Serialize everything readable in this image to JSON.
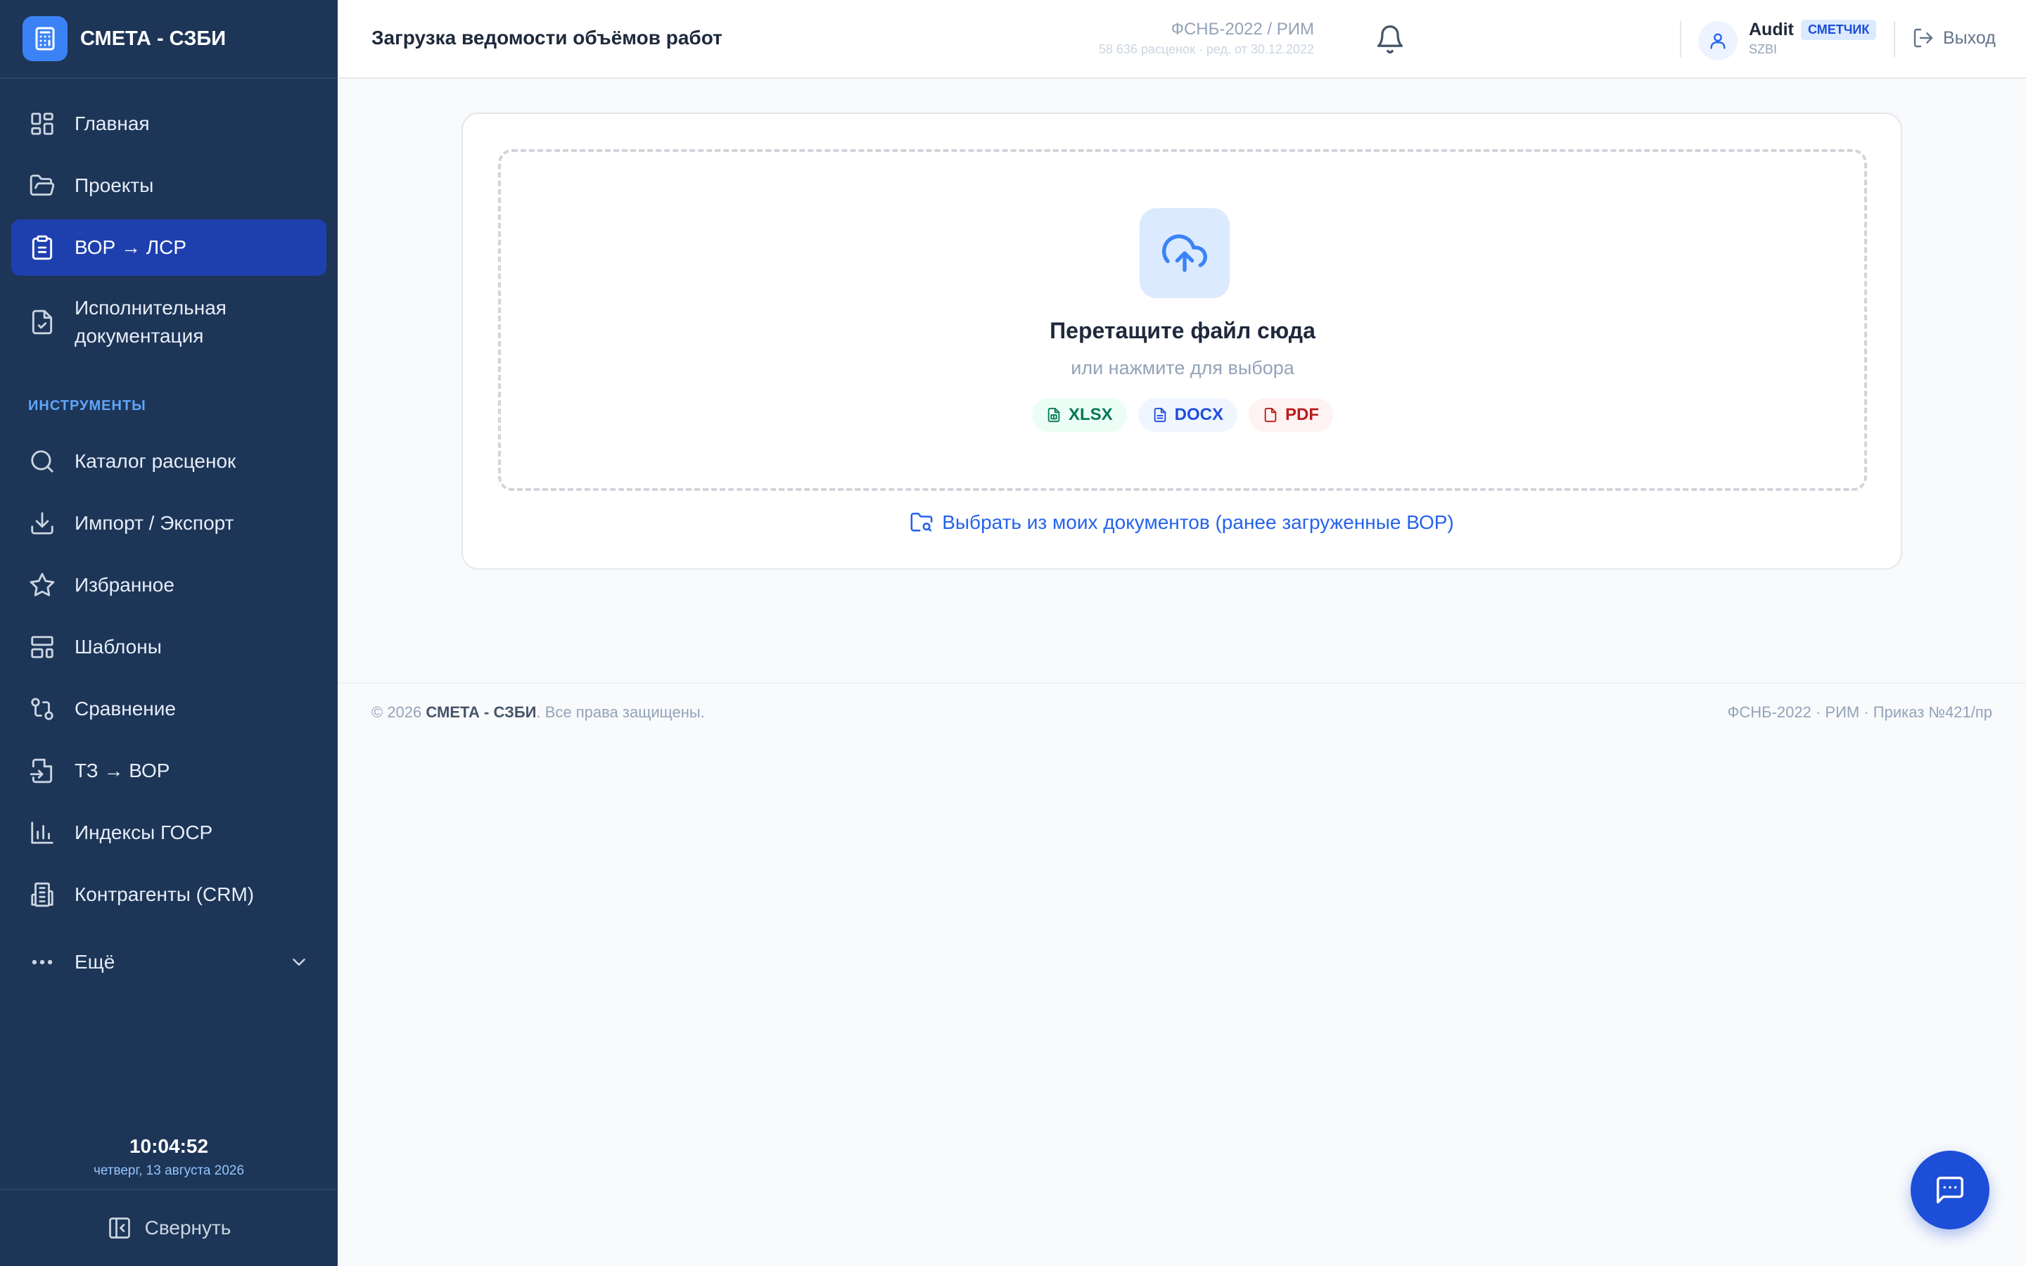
{
  "app": {
    "name": "СМЕТА - СЗБИ"
  },
  "sidebar": {
    "items": [
      {
        "label": "Главная",
        "icon": "dashboard-icon",
        "active": false
      },
      {
        "label": "Проекты",
        "icon": "folder-open-icon",
        "active": false
      },
      {
        "label": "ВОР → ЛСР",
        "icon": "clipboard-icon",
        "active": true
      },
      {
        "label": "Исполнительная документация",
        "icon": "file-check-icon",
        "active": false
      }
    ],
    "tools_section_label": "ИНСТРУМЕНТЫ",
    "tools": [
      {
        "label": "Каталог расценок",
        "icon": "search-icon"
      },
      {
        "label": "Импорт / Экспорт",
        "icon": "download-icon"
      },
      {
        "label": "Избранное",
        "icon": "star-icon"
      },
      {
        "label": "Шаблоны",
        "icon": "layout-template-icon"
      },
      {
        "label": "Сравнение",
        "icon": "git-compare-icon"
      },
      {
        "label": "ТЗ → ВОР",
        "icon": "file-import-icon"
      },
      {
        "label": "Индексы ГОСР",
        "icon": "bar-chart-icon"
      },
      {
        "label": "Контрагенты (CRM)",
        "icon": "building-icon"
      }
    ],
    "more_label": "Ещё",
    "clock_time": "10:04:52",
    "clock_date": "четверг, 13 августа 2026",
    "collapse_label": "Свернуть"
  },
  "header": {
    "title": "Загрузка ведомости объёмов работ",
    "db_name": "ФСНБ-2022 / РИМ",
    "db_details": "58 636 расценок · ред. от 30.12.2022",
    "user_name": "Audit",
    "user_role": "СМЕТЧИК",
    "user_org": "SZBI",
    "logout_label": "Выход"
  },
  "upload": {
    "title": "Перетащите файл сюда",
    "subtitle": "или нажмите для выбора",
    "formats": [
      "XLSX",
      "DOCX",
      "PDF"
    ],
    "pick_link": "Выбрать из моих документов (ранее загруженные ВОР)"
  },
  "footer": {
    "copyright_prefix": "© 2026",
    "copyright_brand": "СМЕТА - СЗБИ",
    "copyright_suffix": ". Все права защищены.",
    "right_text": "ФСНБ-2022 · РИМ · Приказ №421/пр"
  },
  "colors": {
    "sidebar_bg": "#1d3557",
    "active_item_bg": "#1e40af",
    "accent": "#2563eb",
    "brand_logo_bg": "#3b82f6"
  }
}
